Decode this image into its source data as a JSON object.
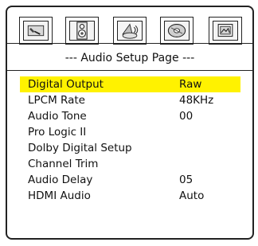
{
  "tabs": [
    {
      "icon": "tool-icon"
    },
    {
      "icon": "speaker-icon"
    },
    {
      "icon": "dolby-sound-icon"
    },
    {
      "icon": "disc-icon"
    },
    {
      "icon": "picture-icon"
    }
  ],
  "page_title": "--- Audio Setup Page ---",
  "menu": [
    {
      "label": "Digital Output",
      "value": "Raw"
    },
    {
      "label": "LPCM Rate",
      "value": "48KHz"
    },
    {
      "label": "Audio Tone",
      "value": "00"
    },
    {
      "label": "Pro Logic II",
      "value": ""
    },
    {
      "label": "Dolby Digital Setup",
      "value": ""
    },
    {
      "label": "Channel Trim",
      "value": ""
    },
    {
      "label": "Audio Delay",
      "value": "05"
    },
    {
      "label": "HDMI Audio",
      "value": "Auto"
    }
  ],
  "selected_index": 0,
  "colors": {
    "highlight": "#fff200",
    "border": "#222222"
  }
}
